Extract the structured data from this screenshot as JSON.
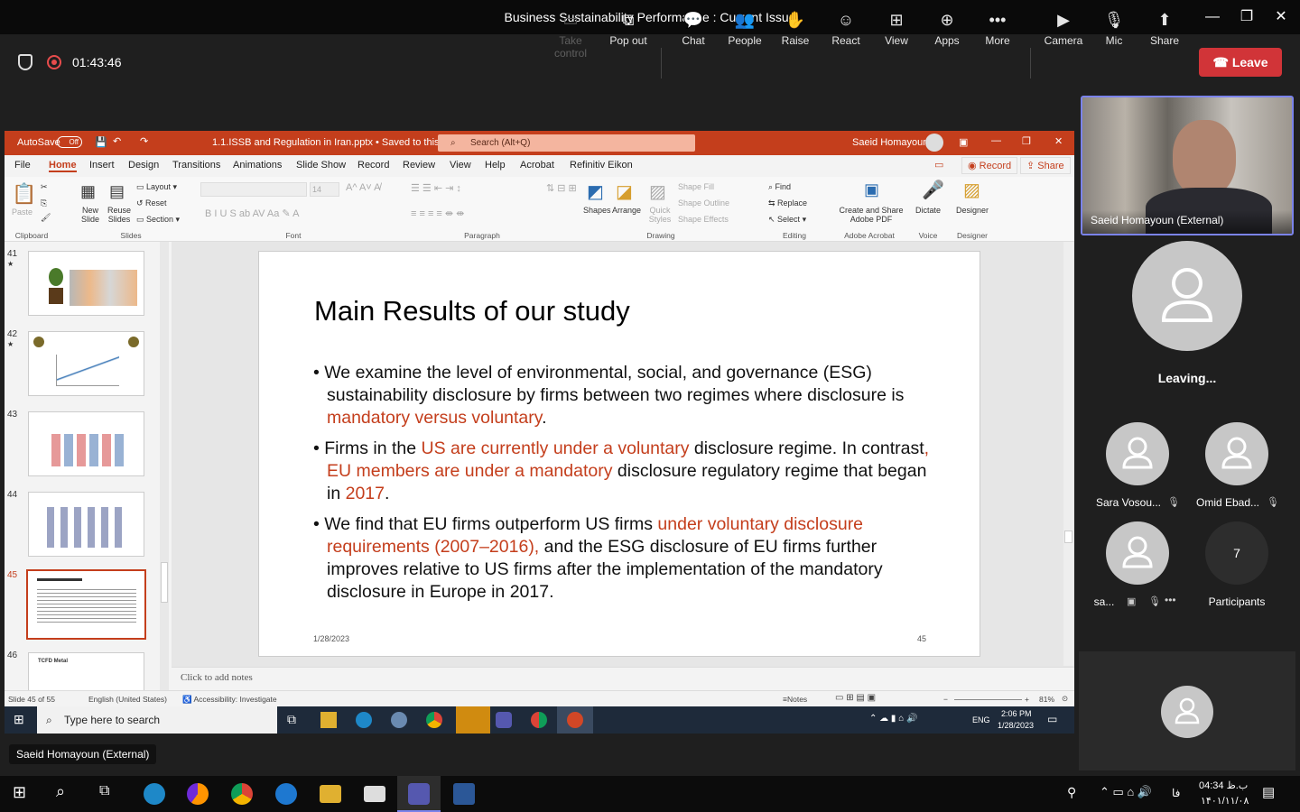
{
  "window": {
    "title": "Business Sustainability Performance : Current Issue"
  },
  "meeting": {
    "timer": "01:43:46",
    "tools": [
      {
        "label": "Take control",
        "icon": "take-control-icon"
      },
      {
        "label": "Pop out",
        "icon": "pop-out-icon"
      },
      {
        "label": "Chat",
        "icon": "chat-icon"
      },
      {
        "label": "People",
        "icon": "people-icon"
      },
      {
        "label": "Raise",
        "icon": "raise-hand-icon"
      },
      {
        "label": "React",
        "icon": "react-icon"
      },
      {
        "label": "View",
        "icon": "view-icon"
      },
      {
        "label": "Apps",
        "icon": "apps-icon"
      },
      {
        "label": "More",
        "icon": "more-icon"
      },
      {
        "label": "Camera",
        "icon": "camera-icon"
      },
      {
        "label": "Mic",
        "icon": "mic-icon"
      },
      {
        "label": "Share",
        "icon": "share-icon"
      }
    ],
    "leave_label": "Leave"
  },
  "ppt": {
    "autosave": "AutoSave",
    "autosave_state": "Off",
    "filename": "1.1.ISSB and Regulation in Iran.pptx • Saved to this PC",
    "search_placeholder": "Search (Alt+Q)",
    "user": "Saeid Homayoun",
    "menu": [
      "File",
      "Home",
      "Insert",
      "Design",
      "Transitions",
      "Animations",
      "Slide Show",
      "Record",
      "Review",
      "View",
      "Help",
      "Acrobat",
      "Refinitiv Eikon"
    ],
    "record_label": "Record",
    "share_label": "Share",
    "ribbon": {
      "paste": "Paste",
      "new_slide": "New Slide",
      "reuse_slides": "Reuse Slides",
      "layout": "Layout",
      "reset": "Reset",
      "section": "Section",
      "font_size": "14",
      "shapes": "Shapes",
      "arrange": "Arrange",
      "quick_styles": "Quick Styles",
      "shape_fill": "Shape Fill",
      "shape_outline": "Shape Outline",
      "shape_effects": "Shape Effects",
      "find": "Find",
      "replace": "Replace",
      "select": "Select",
      "create_share": "Create and Share Adobe PDF",
      "dictate": "Dictate",
      "designer": "Designer",
      "groups": [
        "Clipboard",
        "Slides",
        "Font",
        "Paragraph",
        "Drawing",
        "Editing",
        "Adobe Acrobat",
        "Voice",
        "Designer"
      ]
    },
    "thumbs": [
      {
        "num": "41",
        "star": "★"
      },
      {
        "num": "42",
        "star": "★"
      },
      {
        "num": "43",
        "star": ""
      },
      {
        "num": "44",
        "star": ""
      },
      {
        "num": "45",
        "star": ""
      },
      {
        "num": "46",
        "star": "",
        "title": "TCFD Metal"
      }
    ],
    "slide": {
      "title": "Main Results of our study",
      "b1a": "We examine the level of environmental, social, and governance (ESG) sustainability disclosure by firms between two regimes where disclosure is ",
      "b1b": "mandatory versus voluntary",
      "b1c": ".",
      "b2a": "Firms in the ",
      "b2b": "US are currently under a voluntary",
      "b2c": " disclosure regime. In contrast",
      "b2d": ", EU members are under a mandatory",
      "b2e": " disclosure regulatory regime that began in ",
      "b2f": "2017",
      "b2g": ".",
      "b3a": "We find that EU firms outperform US firms ",
      "b3b": "under voluntary disclosure requirements (2007–2016),",
      "b3c": " and the ESG disclosure of EU firms further improves relative to US firms after the implementation of the mandatory disclosure in Europe in 2017.",
      "date": "1/28/2023",
      "number": "45"
    },
    "notes_placeholder": "Click to add notes",
    "status": {
      "slide": "Slide 45 of 55",
      "lang": "English (United States)",
      "access": "Accessibility: Investigate",
      "notes": "Notes",
      "zoom": "81%"
    },
    "taskbar": {
      "search": "Type here to search",
      "lang": "ENG",
      "time": "2:06 PM",
      "date": "1/28/2023"
    }
  },
  "participants": {
    "presenter": "Saeid Homayoun (External)",
    "leaving": "Leaving...",
    "p1": "Sara Vosou...",
    "p2": "Omid Ebad...",
    "p3": "sa...",
    "count": "7",
    "count_label": "Participants"
  },
  "speaker_label": "Saeid Homayoun (External)",
  "win_taskbar": {
    "time": "04:34 ب.ظ",
    "date": "۱۴۰۱/۱۱/۰۸",
    "lang": "فا"
  }
}
